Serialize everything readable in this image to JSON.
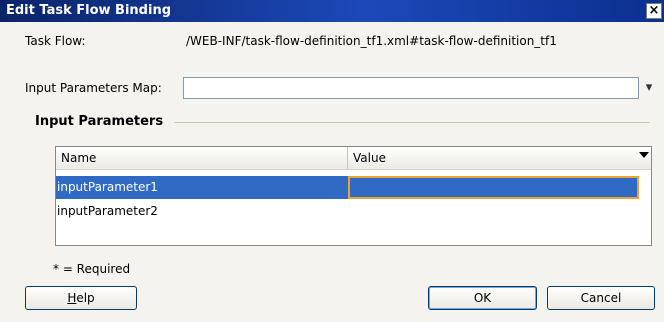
{
  "window": {
    "title": "Edit Task Flow Binding",
    "close_glyph": "×"
  },
  "form": {
    "task_flow_label": "Task Flow:",
    "task_flow_value": "/WEB-INF/task-flow-definition_tf1.xml#task-flow-definition_tf1",
    "input_params_map_label": "Input Parameters Map:",
    "input_params_map_value": "",
    "dropdown_glyph": "▾"
  },
  "input_parameters": {
    "section_title": "Input Parameters",
    "columns": [
      "Name",
      "Value"
    ],
    "rows": [
      {
        "name": "inputParameter1",
        "value": "",
        "selected": true
      },
      {
        "name": "inputParameter2",
        "value": "",
        "selected": false
      }
    ]
  },
  "footnote": "* = Required",
  "buttons": {
    "help_prefix": "",
    "help_mnemonic": "H",
    "help_suffix": "elp",
    "ok": "OK",
    "cancel": "Cancel"
  },
  "colors": {
    "titlebar": "#0a246a",
    "selection": "#316ac5",
    "focus_outline": "#e8a235"
  }
}
